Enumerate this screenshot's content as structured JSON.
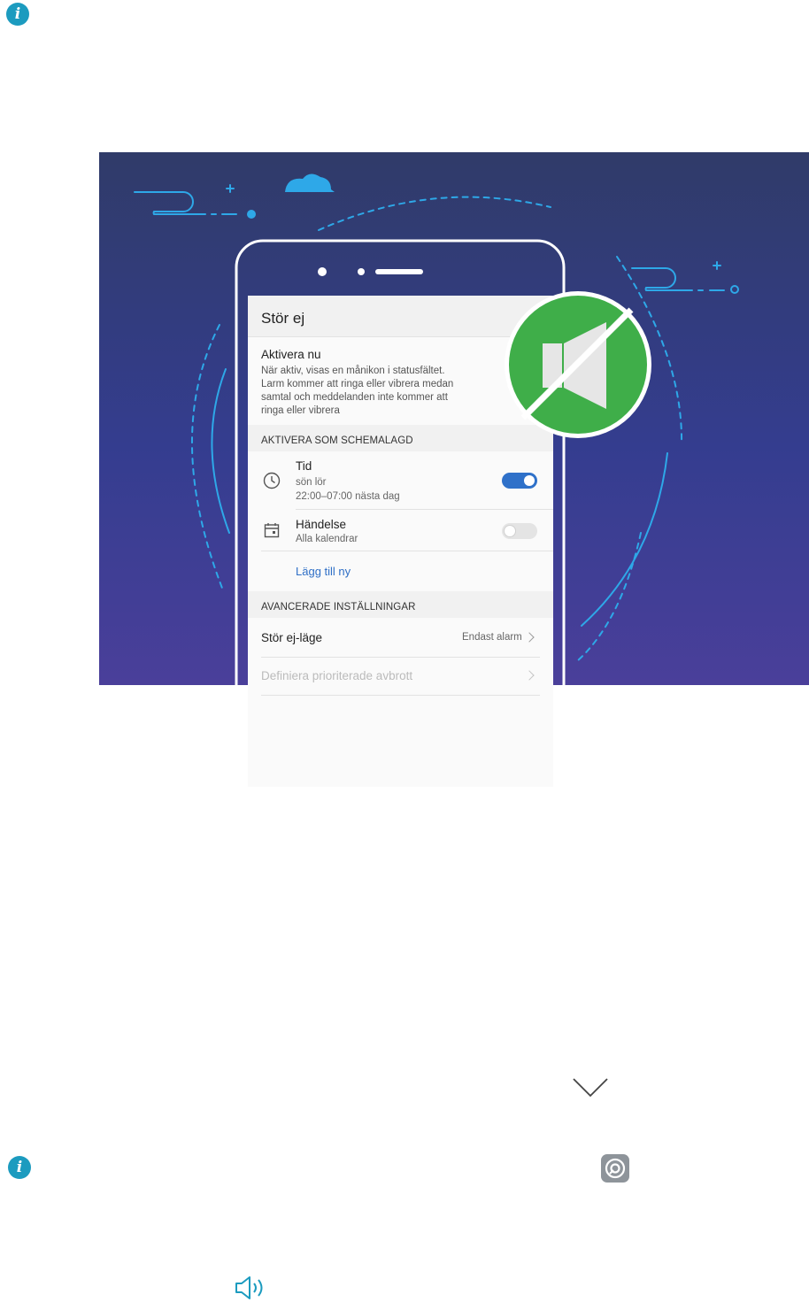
{
  "notes": {
    "top_note_icon": "info-icon",
    "bottom_note_icon": "info-icon"
  },
  "phone": {
    "screen_title": "Stör ej",
    "activate_now": {
      "title": "Aktivera nu",
      "description": [
        "När aktiv, visas en månikon i statusfältet.",
        "Larm kommer att ringa eller vibrera medan",
        "samtal och meddelanden inte kommer att",
        "ringa eller vibrera"
      ]
    },
    "scheduled_section": {
      "header": "AKTIVERA SOM SCHEMALAGD",
      "items": [
        {
          "icon": "clock-icon",
          "title": "Tid",
          "lines": [
            "sön lör",
            "22:00–07:00 nästa dag"
          ],
          "enabled": true
        },
        {
          "icon": "calendar-icon",
          "title": "Händelse",
          "lines": [
            "Alla kalendrar"
          ],
          "enabled": false
        }
      ],
      "add_new": "Lägg till ny"
    },
    "advanced_section": {
      "header": "AVANCERADE INSTÄLLNINGAR",
      "dnd_mode": {
        "title": "Stör ej-läge",
        "value": "Endast alarm"
      },
      "priority": {
        "title": "Definiera prioriterade avbrott"
      }
    }
  },
  "badge": {
    "icon": "speaker-muted-icon",
    "color": "#3fae49"
  },
  "icons": {
    "chevron": "chevron-down-icon",
    "settings": "settings-gear-icon",
    "volume": "volume-icon"
  },
  "colors": {
    "banner_top": "#303b69",
    "banner_bottom": "#4a3f9a",
    "accent_line": "#2ea8e8",
    "toggle_on": "#2f71c9",
    "link": "#2f6fc6",
    "info_icon": "#1c9bbf"
  }
}
